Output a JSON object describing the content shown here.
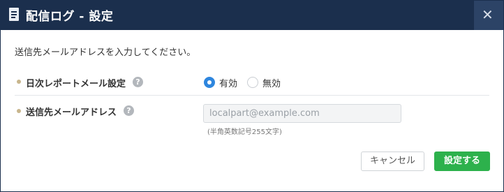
{
  "dialog": {
    "title": "配信ログ - 設定",
    "close_glyph": "✕",
    "intro": "送信先メールアドレスを入力してください。"
  },
  "daily_report": {
    "label": "日次レポートメール設定",
    "help_glyph": "?",
    "options": [
      {
        "label": "有効",
        "selected": true
      },
      {
        "label": "無効",
        "selected": false
      }
    ]
  },
  "email": {
    "label": "送信先メールアドレス",
    "help_glyph": "?",
    "placeholder": "localpart@example.com",
    "value": "",
    "hint": "(半角英数記号255文字)"
  },
  "buttons": {
    "cancel": "キャンセル",
    "save": "設定する"
  },
  "colors": {
    "header": "#1b2f4d",
    "accent": "#2e86de",
    "save": "#2db14c",
    "bullet": "#c8b68d"
  }
}
